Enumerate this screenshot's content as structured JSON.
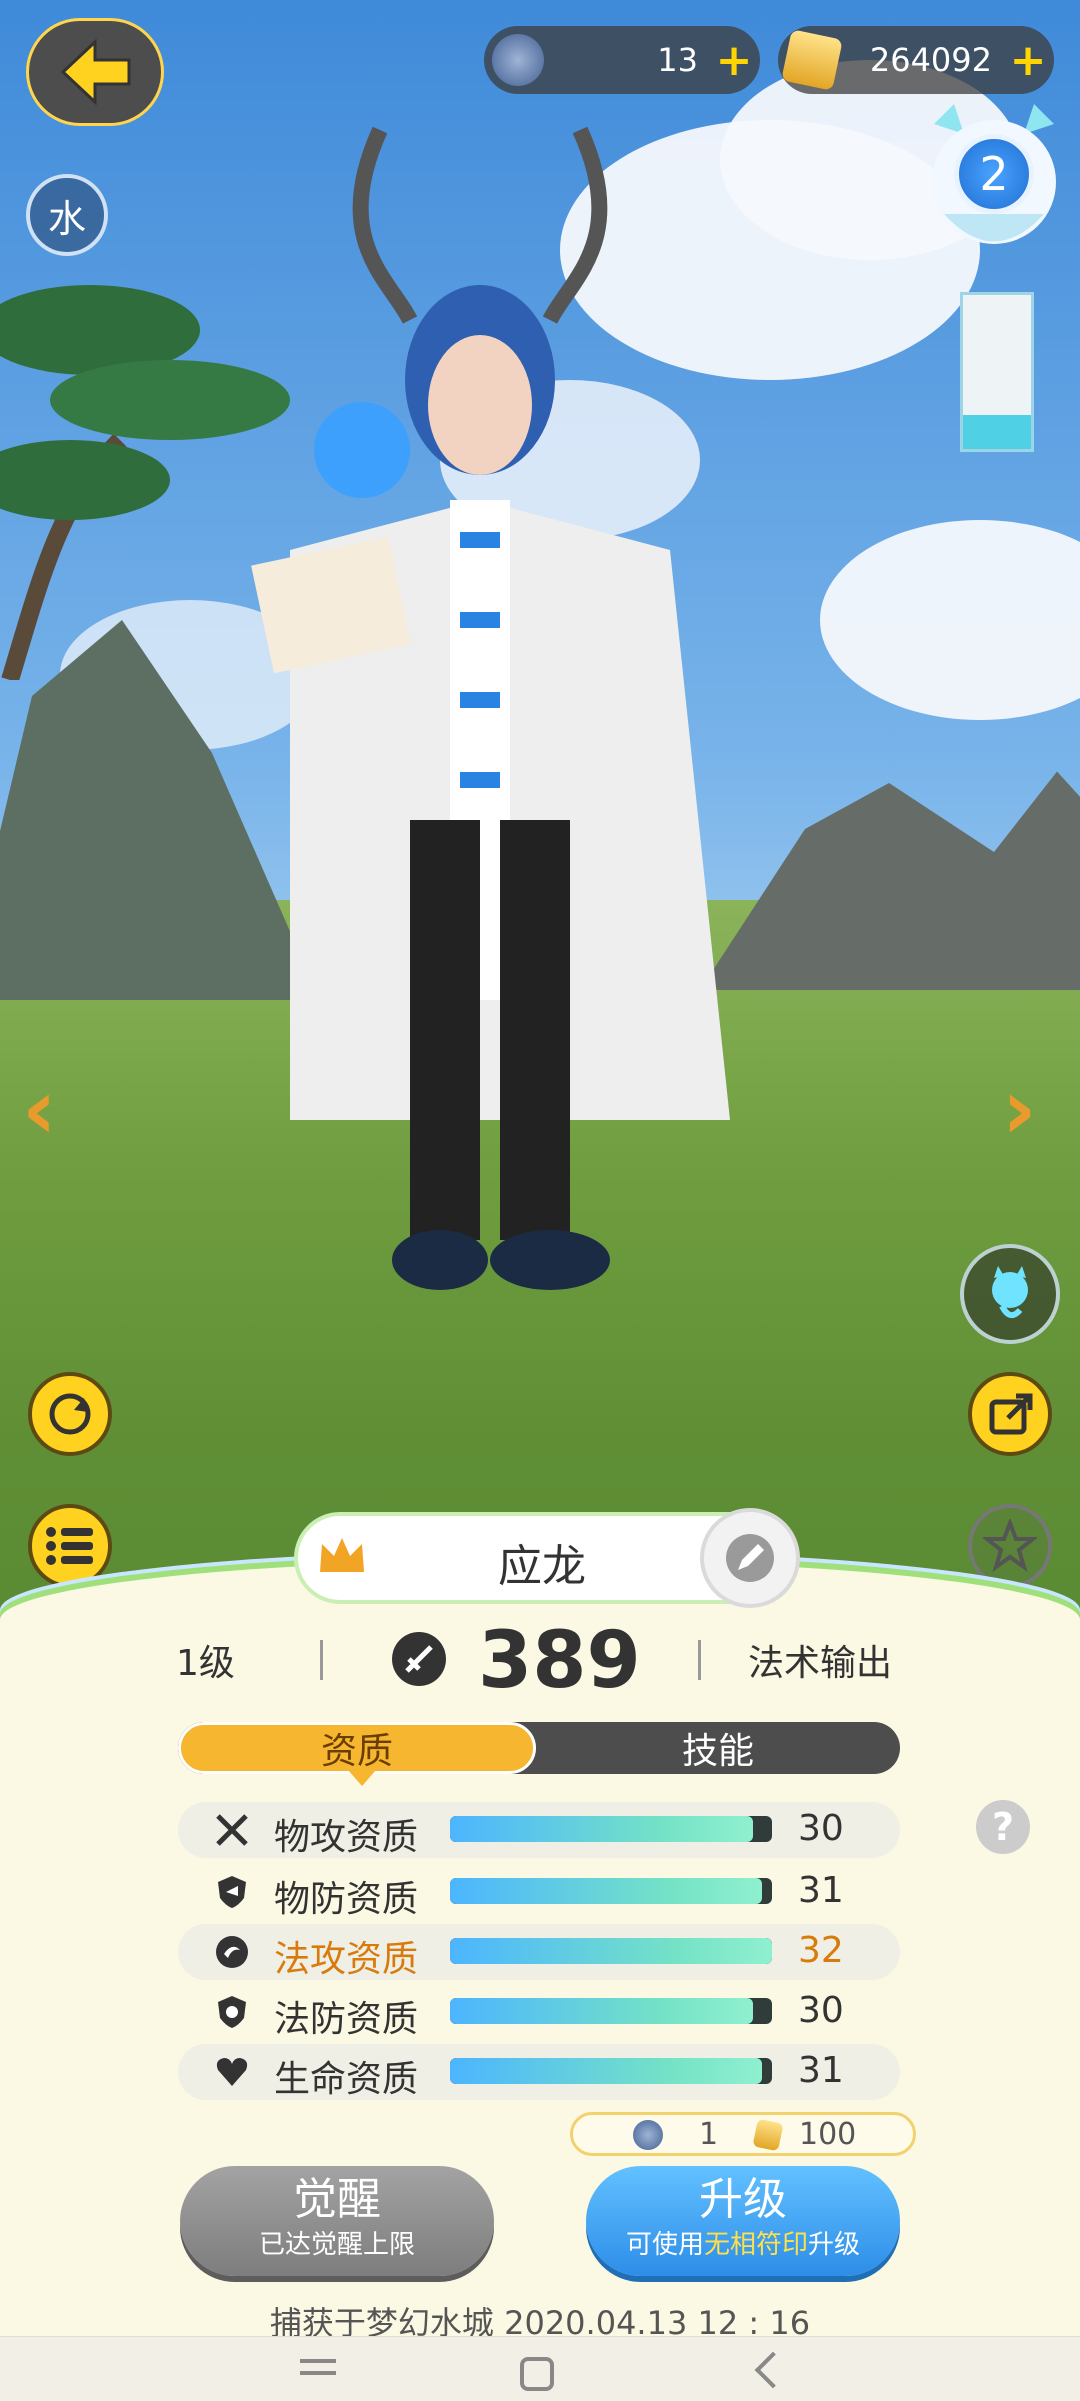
{
  "currency": {
    "tickets": "13",
    "crystals": "264092"
  },
  "element": "水",
  "lantern_level": "2",
  "pet": {
    "name": "应龙",
    "level": "1级",
    "power": "389",
    "role": "法术输出"
  },
  "tabs": {
    "active": "资质",
    "inactive": "技能"
  },
  "attributes": [
    {
      "name": "物攻资质",
      "value": "30",
      "fill": 0.94,
      "icon": "crossed-swords-icon"
    },
    {
      "name": "物防资质",
      "value": "31",
      "fill": 0.97,
      "icon": "shield-icon"
    },
    {
      "name": "法攻资质",
      "value": "32",
      "fill": 1.0,
      "icon": "magic-orb-icon"
    },
    {
      "name": "法防资质",
      "value": "30",
      "fill": 0.94,
      "icon": "magic-shield-icon"
    },
    {
      "name": "生命资质",
      "value": "31",
      "fill": 0.97,
      "icon": "heart-icon"
    }
  ],
  "cost": {
    "tickets": "1",
    "crystals": "100"
  },
  "buttons": {
    "awaken": "觉醒",
    "awaken_sub": "已达觉醒上限",
    "upgrade": "升级",
    "upgrade_sub_pre": "可使用",
    "upgrade_sub_hl": "无相符印",
    "upgrade_sub_post": "升级"
  },
  "capture_info": "捕获于梦幻水城  2020.04.13   12 : 16",
  "colors": {
    "accent_gold": "#f7b62f",
    "highlight_orange": "#d97b0c",
    "upgrade_blue": "#2d8de8"
  }
}
